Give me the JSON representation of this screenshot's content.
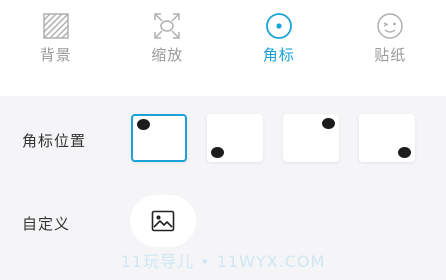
{
  "tabs": [
    {
      "label": "背景",
      "icon": "hatch-pattern-icon",
      "active": false
    },
    {
      "label": "缩放",
      "icon": "scale-frame-icon",
      "active": false
    },
    {
      "label": "角标",
      "icon": "corner-badge-icon",
      "active": true
    },
    {
      "label": "贴纸",
      "icon": "sticker-smiley-icon",
      "active": false
    }
  ],
  "badge_position": {
    "label": "角标位置",
    "options": [
      "top-left",
      "bottom-left",
      "top-right",
      "bottom-right"
    ],
    "selected": "top-left"
  },
  "custom": {
    "label": "自定义",
    "icon": "image-icon"
  },
  "watermark": "11玩导儿 • 11WYX.COM",
  "colors": {
    "accent": "#1aa3d6",
    "inactive": "#9a9a9a",
    "background": "#f5f5f7",
    "dot": "#1c1c1c"
  }
}
